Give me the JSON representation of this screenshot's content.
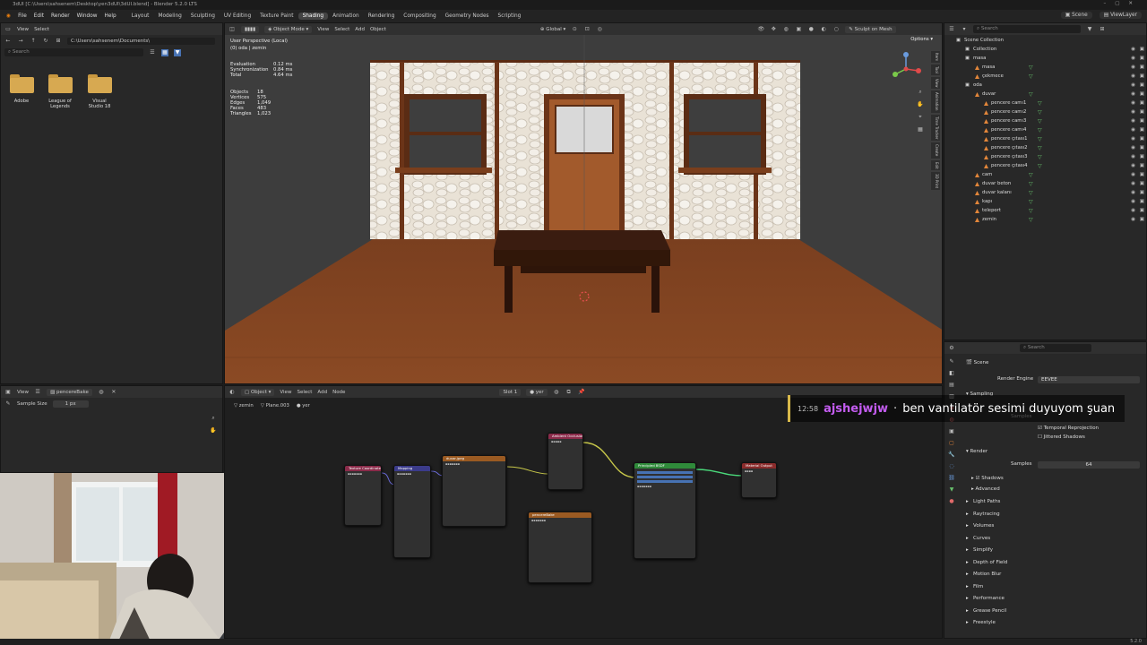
{
  "title_bar": "3dUI [C:\\Users\\sahsenem\\Desktop\\yen3dUI\\3dUI.blend] - Blender 5.2.0 LTS",
  "menu": [
    "File",
    "Edit",
    "Render",
    "Window",
    "Help"
  ],
  "workspaces": [
    "Layout",
    "Modeling",
    "Sculpting",
    "UV Editing",
    "Texture Paint",
    "Shading",
    "Animation",
    "Rendering",
    "Compositing",
    "Geometry Nodes",
    "Scripting"
  ],
  "active_workspace": "Shading",
  "scene_selector": "Scene",
  "view_layer": "ViewLayer",
  "file_browser": {
    "header": [
      "View",
      "Select"
    ],
    "path": "C:\\Users\\sahsenem\\Documents\\",
    "search_placeholder": "Search",
    "folders": [
      "Adobe",
      "League of Legends",
      "Visual Studio 18"
    ]
  },
  "viewport": {
    "mode": "Object Mode",
    "menus": [
      "View",
      "Select",
      "Add",
      "Object"
    ],
    "orientation": "Global",
    "sculpt_button": "Sculpt on Mesh",
    "options": "Options",
    "view_name": "User Perspective (Local)",
    "context": "(0) oda | zemin",
    "timing": [
      [
        "Evaluation",
        "0.12 ms"
      ],
      [
        "Synchronization",
        "0.84 ms"
      ],
      [
        "Total",
        "4.64 ms"
      ]
    ],
    "stats": [
      [
        "Objects",
        "18"
      ],
      [
        "Vertices",
        "575"
      ],
      [
        "Edges",
        "1,049"
      ],
      [
        "Faces",
        "483"
      ],
      [
        "Triangles",
        "1,023"
      ]
    ],
    "side_tabs": [
      "Item",
      "Tool",
      "View",
      "Animation",
      "Time Tracker",
      "Create",
      "Edit",
      "3D Print"
    ]
  },
  "outliner": {
    "search_placeholder": "Search",
    "rows": [
      {
        "name": "Scene Collection",
        "indent": 0,
        "type": "root"
      },
      {
        "name": "Collection",
        "indent": 1,
        "type": "coll"
      },
      {
        "name": "masa",
        "indent": 1,
        "type": "coll"
      },
      {
        "name": "masa",
        "indent": 2,
        "type": "obj"
      },
      {
        "name": "çekmece",
        "indent": 2,
        "type": "obj"
      },
      {
        "name": "oda",
        "indent": 1,
        "type": "coll"
      },
      {
        "name": "duvar",
        "indent": 2,
        "type": "obj"
      },
      {
        "name": "pencere camı1",
        "indent": 3,
        "type": "obj"
      },
      {
        "name": "pencere camı2",
        "indent": 3,
        "type": "obj"
      },
      {
        "name": "pencere camı3",
        "indent": 3,
        "type": "obj"
      },
      {
        "name": "pencere camı4",
        "indent": 3,
        "type": "obj"
      },
      {
        "name": "pencere çıtası1",
        "indent": 3,
        "type": "obj"
      },
      {
        "name": "pencere çıtası2",
        "indent": 3,
        "type": "obj"
      },
      {
        "name": "pencere çıtası3",
        "indent": 3,
        "type": "obj"
      },
      {
        "name": "pencere çıtası4",
        "indent": 3,
        "type": "obj"
      },
      {
        "name": "cam",
        "indent": 2,
        "type": "obj"
      },
      {
        "name": "duvar beton",
        "indent": 2,
        "type": "obj"
      },
      {
        "name": "duvar kalanı",
        "indent": 2,
        "type": "obj"
      },
      {
        "name": "kapı",
        "indent": 2,
        "type": "obj"
      },
      {
        "name": "teleport",
        "indent": 2,
        "type": "obj"
      },
      {
        "name": "zemin",
        "indent": 2,
        "type": "obj"
      }
    ]
  },
  "properties": {
    "search_placeholder": "Search",
    "scene_label": "Scene",
    "render_engine_label": "Render Engine",
    "render_engine": "EEVEE",
    "sampling": "Sampling",
    "samples_label": "Samples",
    "temporal": "Temporal Reprojection",
    "jittered": "Jittered Shadows",
    "render_section": "Render",
    "samples_value": "64",
    "shadows": "Shadows",
    "advanced": "Advanced",
    "sections": [
      "Light Paths",
      "Raytracing",
      "Volumes",
      "Curves",
      "Simplify",
      "Depth of Field",
      "Motion Blur",
      "Film",
      "Performance",
      "Grease Pencil",
      "Freestyle"
    ]
  },
  "image_editor": {
    "view": "View",
    "image_name": "pencereBake",
    "sample_size_label": "Sample Size",
    "sample_size_value": "1 px"
  },
  "node_editor": {
    "type": "Object",
    "menus": [
      "View",
      "Select",
      "Add",
      "Node"
    ],
    "slot": "Slot 1",
    "material": "yer",
    "breadcrumb": [
      "zemin",
      "Plane.003",
      "yer"
    ],
    "nodes": {
      "texcoord": "Texture Coordinate",
      "mapping": "Mapping",
      "image": "duvar.jpeg",
      "ao": "Ambient Occlusion",
      "bake": "pencereBake",
      "bsdf": "Principled BSDF",
      "output": "Material Output"
    }
  },
  "chat": {
    "time": "12:58",
    "user": "ajshejwjw",
    "sep": "·",
    "message": "ben vantilatör sesimi duyuyom şuan",
    "user_color": "#c35cf0"
  },
  "status_version": "5.2.0"
}
